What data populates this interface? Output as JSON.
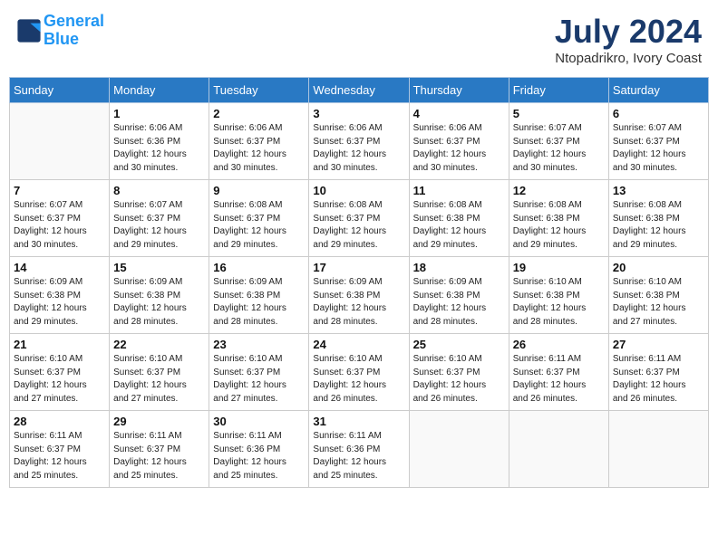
{
  "header": {
    "logo_line1": "General",
    "logo_line2": "Blue",
    "month": "July 2024",
    "location": "Ntopadrikro, Ivory Coast"
  },
  "weekdays": [
    "Sunday",
    "Monday",
    "Tuesday",
    "Wednesday",
    "Thursday",
    "Friday",
    "Saturday"
  ],
  "weeks": [
    [
      {
        "day": "",
        "info": ""
      },
      {
        "day": "1",
        "info": "Sunrise: 6:06 AM\nSunset: 6:36 PM\nDaylight: 12 hours\nand 30 minutes."
      },
      {
        "day": "2",
        "info": "Sunrise: 6:06 AM\nSunset: 6:37 PM\nDaylight: 12 hours\nand 30 minutes."
      },
      {
        "day": "3",
        "info": "Sunrise: 6:06 AM\nSunset: 6:37 PM\nDaylight: 12 hours\nand 30 minutes."
      },
      {
        "day": "4",
        "info": "Sunrise: 6:06 AM\nSunset: 6:37 PM\nDaylight: 12 hours\nand 30 minutes."
      },
      {
        "day": "5",
        "info": "Sunrise: 6:07 AM\nSunset: 6:37 PM\nDaylight: 12 hours\nand 30 minutes."
      },
      {
        "day": "6",
        "info": "Sunrise: 6:07 AM\nSunset: 6:37 PM\nDaylight: 12 hours\nand 30 minutes."
      }
    ],
    [
      {
        "day": "7",
        "info": "Sunrise: 6:07 AM\nSunset: 6:37 PM\nDaylight: 12 hours\nand 30 minutes."
      },
      {
        "day": "8",
        "info": "Sunrise: 6:07 AM\nSunset: 6:37 PM\nDaylight: 12 hours\nand 29 minutes."
      },
      {
        "day": "9",
        "info": "Sunrise: 6:08 AM\nSunset: 6:37 PM\nDaylight: 12 hours\nand 29 minutes."
      },
      {
        "day": "10",
        "info": "Sunrise: 6:08 AM\nSunset: 6:37 PM\nDaylight: 12 hours\nand 29 minutes."
      },
      {
        "day": "11",
        "info": "Sunrise: 6:08 AM\nSunset: 6:38 PM\nDaylight: 12 hours\nand 29 minutes."
      },
      {
        "day": "12",
        "info": "Sunrise: 6:08 AM\nSunset: 6:38 PM\nDaylight: 12 hours\nand 29 minutes."
      },
      {
        "day": "13",
        "info": "Sunrise: 6:08 AM\nSunset: 6:38 PM\nDaylight: 12 hours\nand 29 minutes."
      }
    ],
    [
      {
        "day": "14",
        "info": "Sunrise: 6:09 AM\nSunset: 6:38 PM\nDaylight: 12 hours\nand 29 minutes."
      },
      {
        "day": "15",
        "info": "Sunrise: 6:09 AM\nSunset: 6:38 PM\nDaylight: 12 hours\nand 28 minutes."
      },
      {
        "day": "16",
        "info": "Sunrise: 6:09 AM\nSunset: 6:38 PM\nDaylight: 12 hours\nand 28 minutes."
      },
      {
        "day": "17",
        "info": "Sunrise: 6:09 AM\nSunset: 6:38 PM\nDaylight: 12 hours\nand 28 minutes."
      },
      {
        "day": "18",
        "info": "Sunrise: 6:09 AM\nSunset: 6:38 PM\nDaylight: 12 hours\nand 28 minutes."
      },
      {
        "day": "19",
        "info": "Sunrise: 6:10 AM\nSunset: 6:38 PM\nDaylight: 12 hours\nand 28 minutes."
      },
      {
        "day": "20",
        "info": "Sunrise: 6:10 AM\nSunset: 6:38 PM\nDaylight: 12 hours\nand 27 minutes."
      }
    ],
    [
      {
        "day": "21",
        "info": "Sunrise: 6:10 AM\nSunset: 6:37 PM\nDaylight: 12 hours\nand 27 minutes."
      },
      {
        "day": "22",
        "info": "Sunrise: 6:10 AM\nSunset: 6:37 PM\nDaylight: 12 hours\nand 27 minutes."
      },
      {
        "day": "23",
        "info": "Sunrise: 6:10 AM\nSunset: 6:37 PM\nDaylight: 12 hours\nand 27 minutes."
      },
      {
        "day": "24",
        "info": "Sunrise: 6:10 AM\nSunset: 6:37 PM\nDaylight: 12 hours\nand 26 minutes."
      },
      {
        "day": "25",
        "info": "Sunrise: 6:10 AM\nSunset: 6:37 PM\nDaylight: 12 hours\nand 26 minutes."
      },
      {
        "day": "26",
        "info": "Sunrise: 6:11 AM\nSunset: 6:37 PM\nDaylight: 12 hours\nand 26 minutes."
      },
      {
        "day": "27",
        "info": "Sunrise: 6:11 AM\nSunset: 6:37 PM\nDaylight: 12 hours\nand 26 minutes."
      }
    ],
    [
      {
        "day": "28",
        "info": "Sunrise: 6:11 AM\nSunset: 6:37 PM\nDaylight: 12 hours\nand 25 minutes."
      },
      {
        "day": "29",
        "info": "Sunrise: 6:11 AM\nSunset: 6:37 PM\nDaylight: 12 hours\nand 25 minutes."
      },
      {
        "day": "30",
        "info": "Sunrise: 6:11 AM\nSunset: 6:36 PM\nDaylight: 12 hours\nand 25 minutes."
      },
      {
        "day": "31",
        "info": "Sunrise: 6:11 AM\nSunset: 6:36 PM\nDaylight: 12 hours\nand 25 minutes."
      },
      {
        "day": "",
        "info": ""
      },
      {
        "day": "",
        "info": ""
      },
      {
        "day": "",
        "info": ""
      }
    ]
  ]
}
